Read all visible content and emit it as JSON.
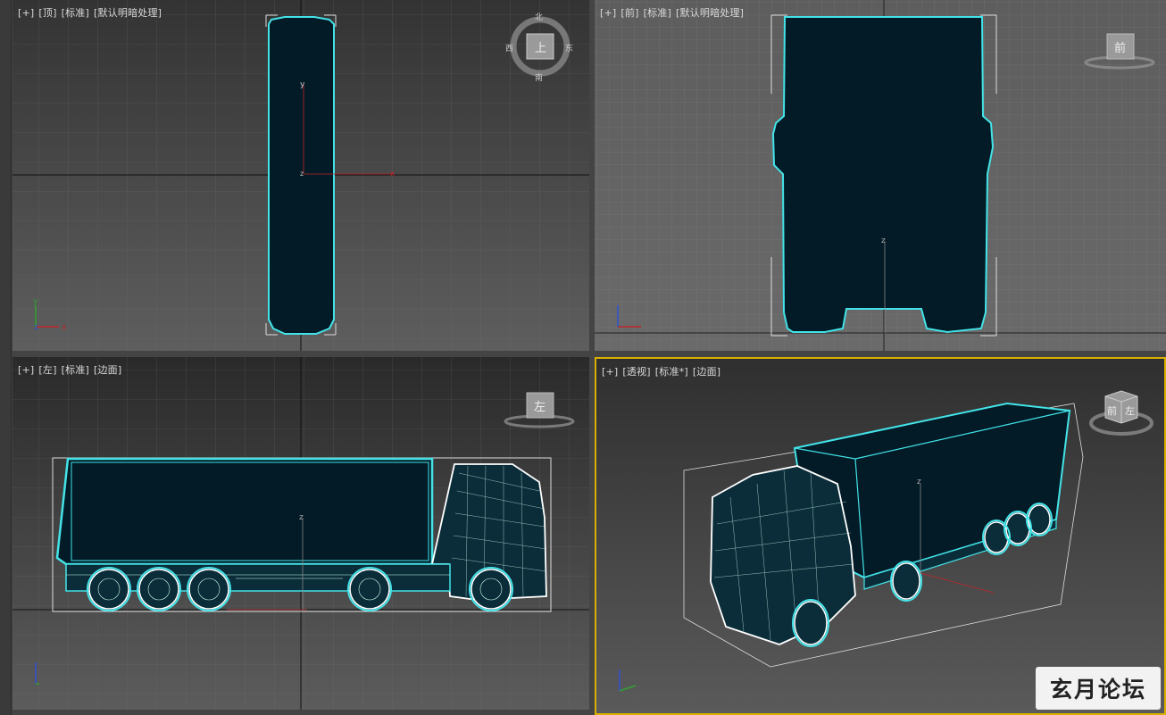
{
  "viewports": {
    "top": {
      "labels": [
        "[+]",
        "[顶]",
        "[标准]",
        "[默认明暗处理]"
      ],
      "compass": {
        "north": "北",
        "south": "南",
        "east": "东",
        "west": "西",
        "face": "上"
      }
    },
    "front": {
      "labels": [
        "[+]",
        "[前]",
        "[标准]",
        "[默认明暗处理]"
      ],
      "cube_face": "前"
    },
    "left": {
      "labels": [
        "[+]",
        "[左]",
        "[标准]",
        "[边面]"
      ],
      "cube_face": "左"
    },
    "perspective": {
      "labels": [
        "[+]",
        "[透视]",
        "[标准*]",
        "[边面]"
      ],
      "cube_faces": [
        "前",
        "左"
      ]
    }
  },
  "axes": {
    "x": "x",
    "y": "y",
    "z": "z"
  },
  "watermark": "玄月论坛",
  "colors": {
    "wire": "#43e3e8",
    "fill": "#021b26",
    "active_border": "#d9b000",
    "axis_x": "#c0262a",
    "axis_y": "#30a030",
    "axis_z": "#3050d0"
  }
}
